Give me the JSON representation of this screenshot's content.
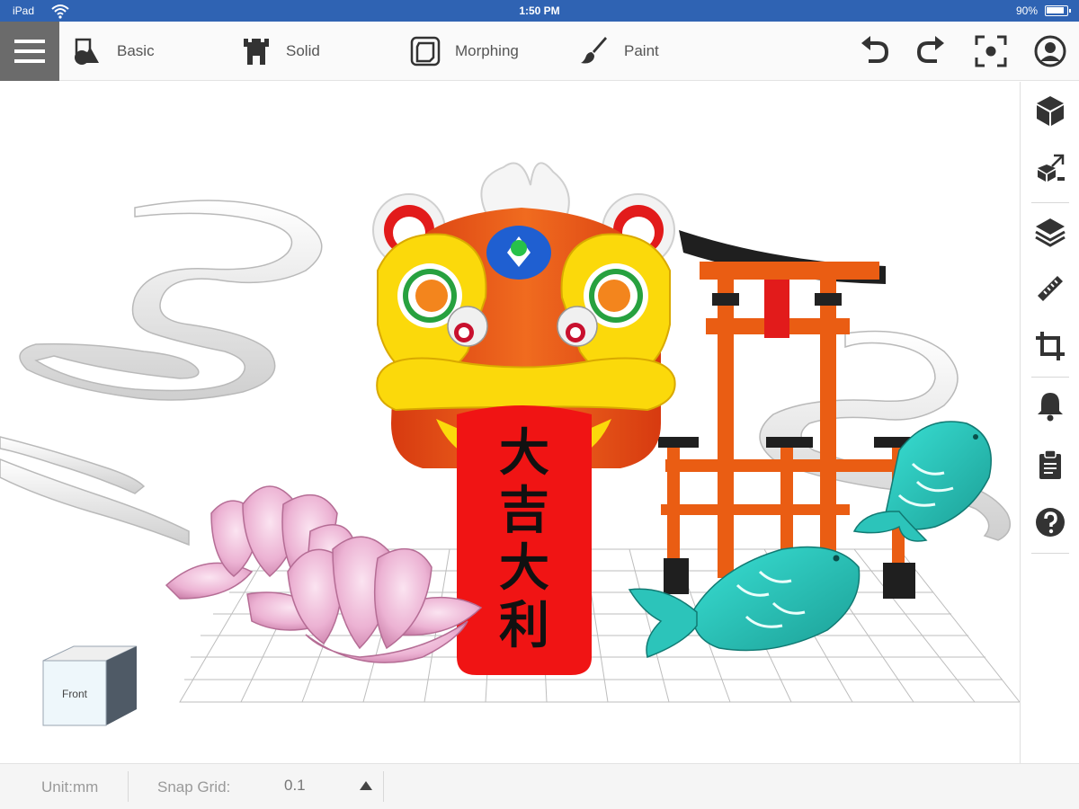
{
  "status_bar": {
    "carrier": "iPad",
    "time": "1:50 PM",
    "battery": "90%"
  },
  "toolbar": {
    "menu_icon": "hamburger-menu-icon",
    "tools": [
      {
        "label": "Basic",
        "icon": "shapes-icon"
      },
      {
        "label": "Solid",
        "icon": "tower-icon"
      },
      {
        "label": "Morphing",
        "icon": "morph-cube-icon"
      },
      {
        "label": "Paint",
        "icon": "paintbrush-icon"
      }
    ],
    "actions": [
      "undo-icon",
      "redo-icon",
      "focus-view-icon",
      "user-account-icon"
    ]
  },
  "sidebar": {
    "items": [
      "cube-icon",
      "transform-icon",
      "layers-icon",
      "ruler-icon",
      "crop-icon",
      "bell-icon",
      "clipboard-icon",
      "help-icon"
    ]
  },
  "viewport": {
    "view_cube_label": "Front",
    "banner_text": [
      "大",
      "吉",
      "大",
      "利"
    ]
  },
  "bottom_bar": {
    "unit": "Unit:mm",
    "snap_label": "Snap Grid:",
    "snap_value": "0.1"
  }
}
